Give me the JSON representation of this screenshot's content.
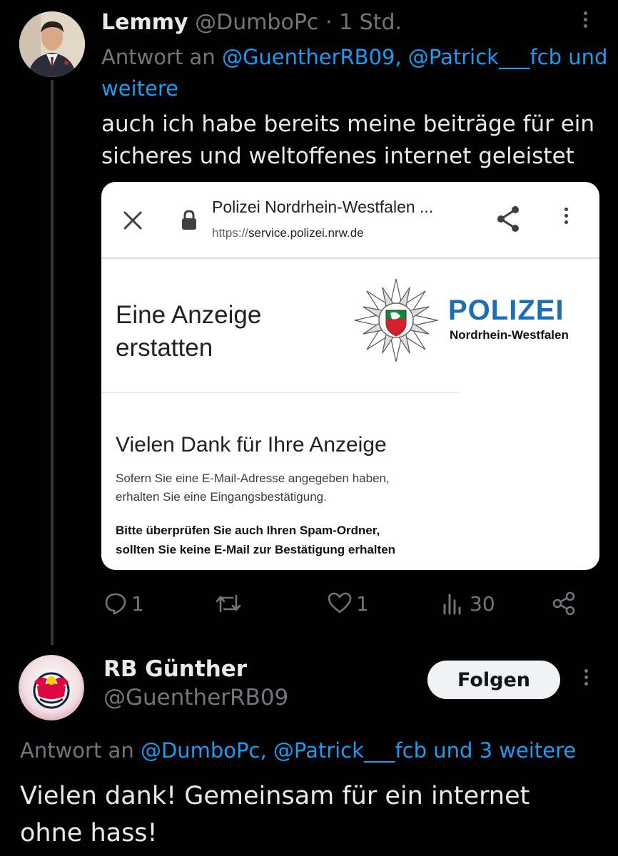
{
  "tweet1": {
    "author_name": "Lemmy",
    "handle": "@DumboPc",
    "separator": "·",
    "time": "1 Std.",
    "reply_prefix": "Antwort an",
    "mention1": "@GuentherRB09,",
    "mention2": "@Patrick___fcb",
    "reply_more": "und",
    "reply_more2": "weitere",
    "text_line1": "auch ich habe bereits meine beiträge für ein",
    "text_line2": "sicheres und weltoffenes internet geleistet",
    "embedded": {
      "page_title": "Polizei Nordrhein-Westfalen ...",
      "url_scheme": "https://",
      "url_host": "service.polizei.nrw.de",
      "heading_line1": "Eine Anzeige",
      "heading_line2": "erstatten",
      "brand": "POLIZEI",
      "brand_sub": "Nordrhein-Westfalen",
      "thanks_heading": "Vielen Dank für Ihre Anzeige",
      "info_line1": "Sofern Sie eine E-Mail-Adresse angegeben haben,",
      "info_line2": "erhalten Sie eine Eingangsbestätigung.",
      "spam_line1": "Bitte überprüfen Sie auch Ihren Spam-Ordner,",
      "spam_line2": "sollten Sie keine E-Mail zur Bestätigung erhalten"
    },
    "actions": {
      "replies": "1",
      "retweets": "",
      "likes": "1",
      "views": "30"
    }
  },
  "tweet2": {
    "author_name": "RB Günther",
    "handle": "@GuentherRB09",
    "follow_label": "Folgen",
    "reply_line": {
      "prefix": "Antwort an",
      "mentions": "@DumboPc, @Patrick___fcb und 3 weitere"
    },
    "text_line1": "Vielen dank! Gemeinsam für ein internet",
    "text_line2": "ohne hass!"
  },
  "colors": {
    "background": "#000000",
    "text": "#e7e9ea",
    "muted": "#71767b",
    "link": "#1d9bf0",
    "polizei_blue": "#1d6fb4"
  }
}
